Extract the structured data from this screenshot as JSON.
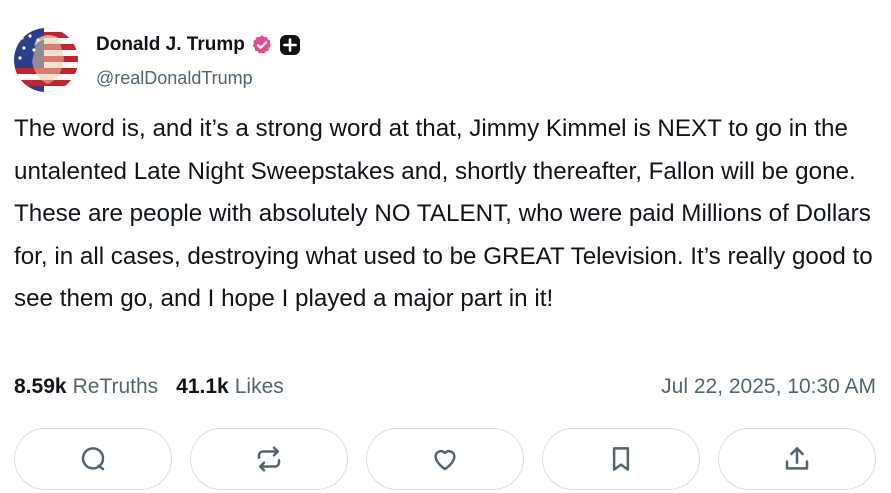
{
  "author": {
    "display_name": "Donald J. Trump",
    "handle": "@realDonaldTrump",
    "avatar_icon": "flag-portrait-avatar",
    "verified_icon": "verified-badge-icon",
    "subscription_icon": "plus-badge-icon",
    "verified_color": "#e8498f"
  },
  "post": {
    "text": "The word is, and it’s a strong word at that, Jimmy Kimmel is NEXT to go in the untalented Late Night Sweepstakes and, shortly thereafter, Fallon will be gone. These are people with absolutely NO TALENT, who were paid Millions of Dollars for, in all cases, destroying what used to be GREAT Television. It’s really good to see them go, and I hope I played a major part in it!"
  },
  "stats": {
    "retruths_count": "8.59k",
    "retruths_label": "ReTruths",
    "likes_count": "41.1k",
    "likes_label": "Likes",
    "timestamp": "Jul 22, 2025, 10:30 AM"
  },
  "actions": [
    {
      "name": "reply",
      "icon": "comment-icon"
    },
    {
      "name": "retruth",
      "icon": "repost-icon"
    },
    {
      "name": "like",
      "icon": "heart-icon"
    },
    {
      "name": "bookmark",
      "icon": "bookmark-icon"
    },
    {
      "name": "share",
      "icon": "share-icon"
    }
  ]
}
